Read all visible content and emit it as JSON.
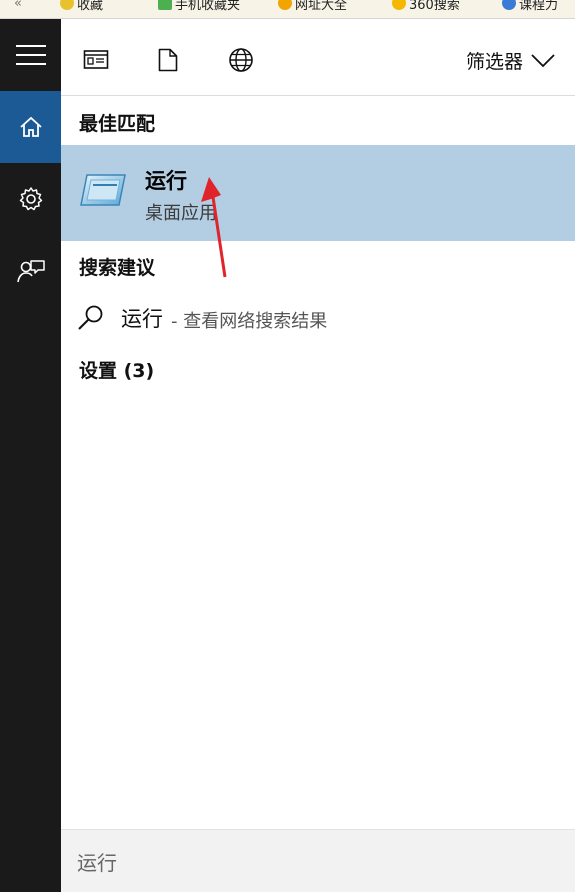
{
  "browser_bookmarks": [
    {
      "label": "收藏",
      "icon": "star-icon",
      "color": "#e8c22c"
    },
    {
      "label": "手机收藏夹",
      "icon": "phone-icon",
      "color": "#4caf50"
    },
    {
      "label": "网址大全",
      "icon": "globe-icon",
      "color": "#f2a400"
    },
    {
      "label": "360搜索",
      "icon": "search-logo-icon",
      "color": "#f5b800"
    },
    {
      "label": "课程力",
      "icon": "course-icon",
      "color": "#3a7bd5"
    }
  ],
  "rail": {
    "items": [
      {
        "name": "menu",
        "icon": "hamburger-icon"
      },
      {
        "name": "home",
        "icon": "home-icon",
        "active": true
      },
      {
        "name": "settings",
        "icon": "gear-icon"
      },
      {
        "name": "feedback",
        "icon": "feedback-icon"
      }
    ]
  },
  "toolbar": {
    "icons": [
      "apps-icon",
      "document-icon",
      "web-icon"
    ],
    "filter_label": "筛选器"
  },
  "sections": {
    "best_match_title": "最佳匹配",
    "suggestions_title": "搜索建议",
    "settings_title": "设置 (3)"
  },
  "best_match": {
    "name": "运行",
    "type": "桌面应用",
    "icon": "run-app-icon"
  },
  "suggestion": {
    "query": "运行",
    "description": "- 查看网络搜索结果"
  },
  "search": {
    "value": "运行"
  },
  "colors": {
    "rail_bg": "#1a1a1a",
    "rail_active": "#1c5a95",
    "best_match_bg": "#b3cee3",
    "annotation_arrow": "#e0242b"
  }
}
